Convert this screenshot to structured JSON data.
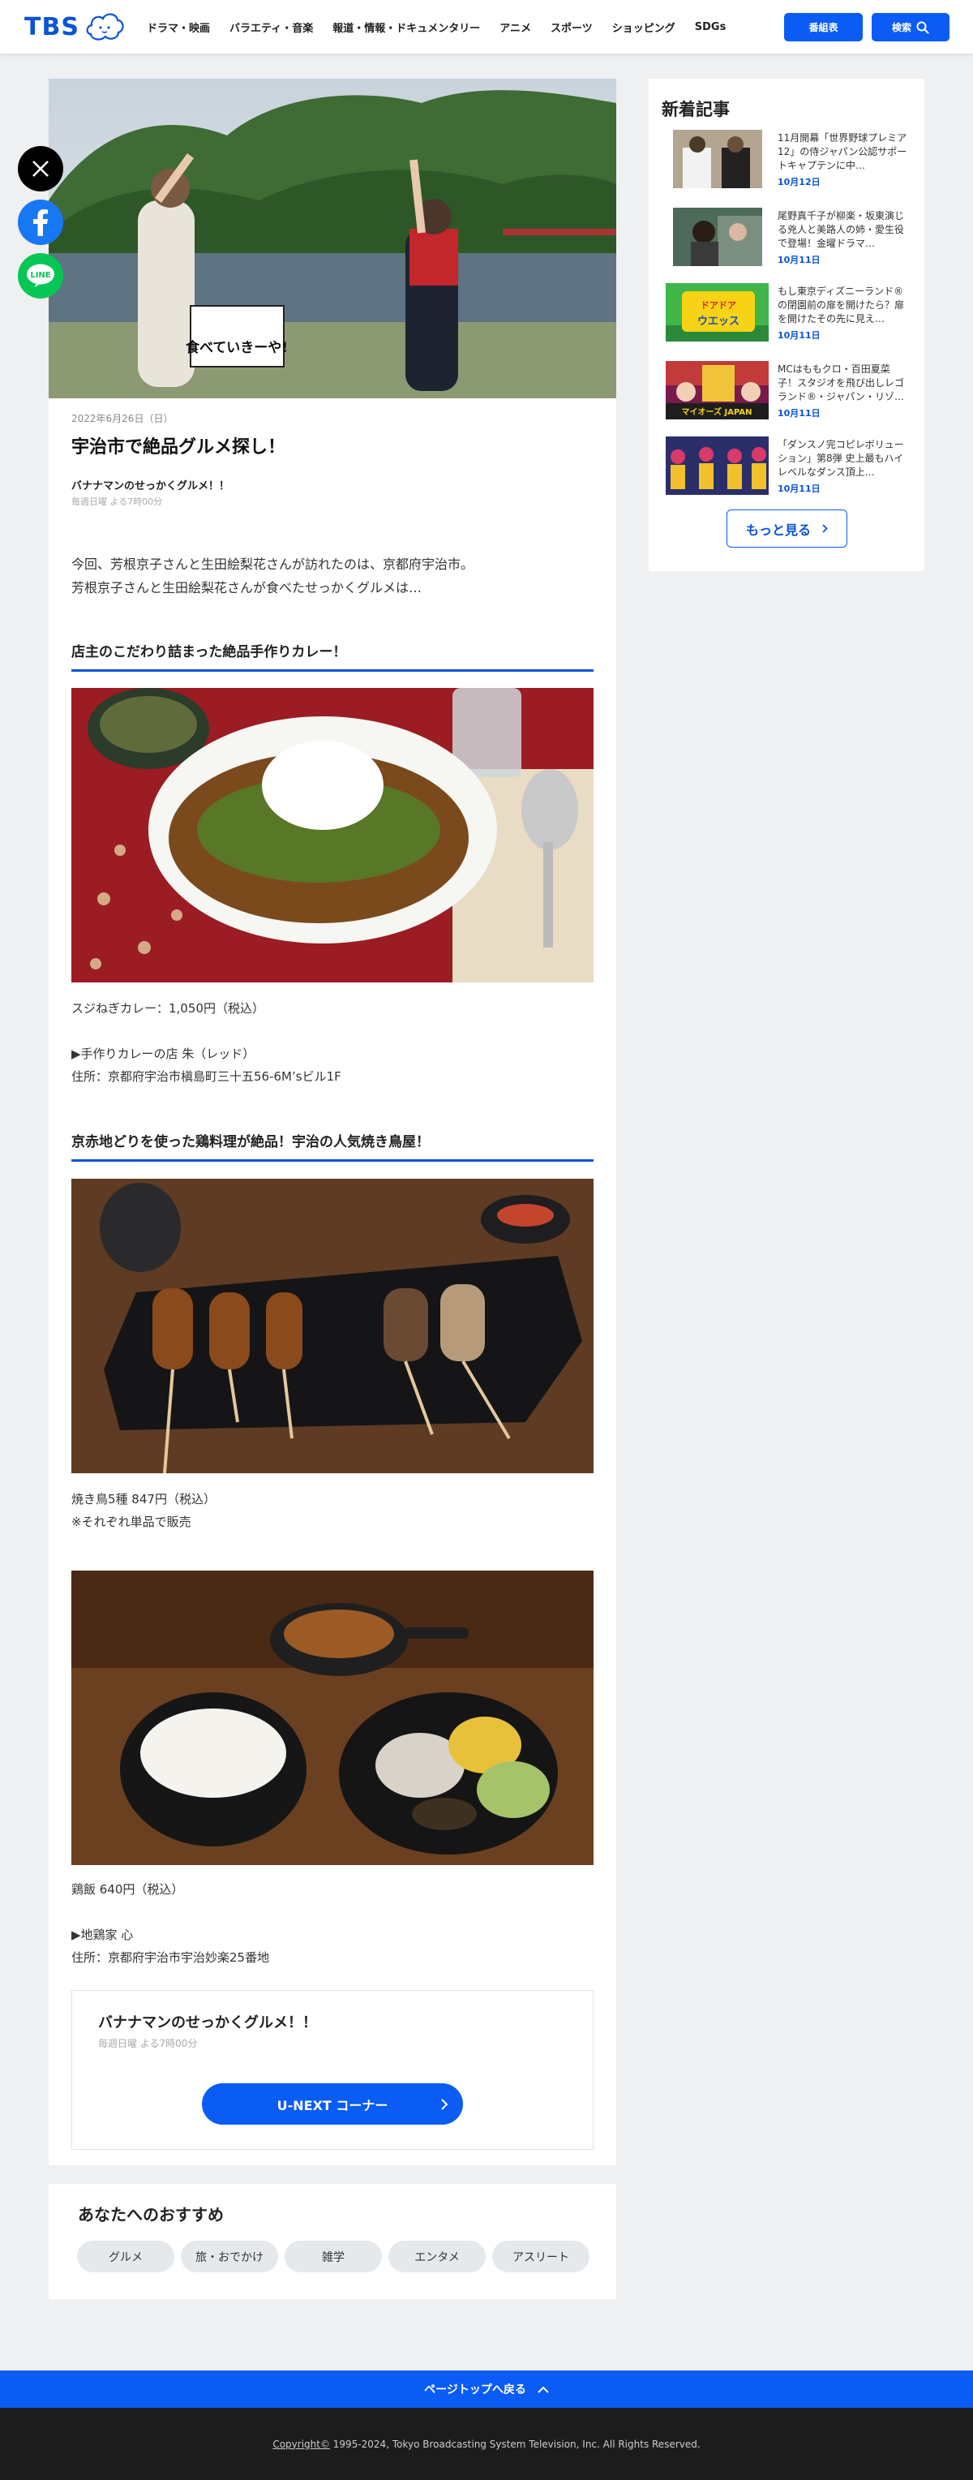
{
  "header": {
    "logo": "TBS",
    "nav": [
      "ドラマ・映画",
      "バラエティ・音楽",
      "報道・情報・ドキュメンタリー",
      "アニメ",
      "スポーツ",
      "ショッピング",
      "SDGs"
    ],
    "schedule_btn": "番組表",
    "search_btn": "検索"
  },
  "social": [
    "x-icon",
    "facebook-icon",
    "line-icon"
  ],
  "article": {
    "hero_sign": "食べていきーや!",
    "date": "2022年6月26日（日）",
    "title": "宇治市で絶品グルメ探し！",
    "program": "バナナマンのせっかくグルメ！！",
    "schedule": "毎週日曜 よる7時00分",
    "lead": [
      "今回、芳根京子さんと生田絵梨花さんが訪れたのは、京都府宇治市。",
      "芳根京子さんと生田絵梨花さんが食べたせっかくグルメは…"
    ],
    "sections": [
      {
        "heading": "店主のこだわり詰まった絶品手作りカレー！",
        "lines": [
          "スジねぎカレー：1,050円（税込）",
          "",
          "▶手作りカレーの店 朱（レッド）",
          "住所：京都府宇治市槇島町三十五56-6M’sビル1F"
        ]
      },
      {
        "heading": "京赤地どりを使った鶏料理が絶品！宇治の人気焼き鳥屋！",
        "lines": [
          "焼き鳥5種 847円（税込）",
          "※それぞれ単品で販売"
        ],
        "lines2": [
          "鶏飯 640円（税込）",
          "",
          "▶地鶏家 心",
          "住所：京都府宇治市宇治妙楽25番地"
        ]
      }
    ],
    "program_box": {
      "title": "バナナマンのせっかくグルメ！！",
      "schedule": "毎週日曜 よる7時00分",
      "button": "U-NEXT コーナー"
    }
  },
  "recommend": {
    "title": "あなたへのおすすめ",
    "tags": [
      "グルメ",
      "旅・おでかけ",
      "雑学",
      "エンタメ",
      "アスリート"
    ]
  },
  "sidebar": {
    "title": "新着記事",
    "items": [
      {
        "text": "11月開幕「世界野球プレミア12」の侍ジャパン公認サポートキャプテンに中…",
        "date": "10月12日"
      },
      {
        "text": "尾野真千子が柳楽・坂東演じる兇人と美路人の姉・愛生役で登場！金曜ドラマ…",
        "date": "10月11日"
      },
      {
        "text": "もし東京ディズニーランド®の閉園前の扉を開けたら？扉を開けたその先に見え…",
        "date": "10月11日"
      },
      {
        "text": "MCはももクロ・百田夏菜子！スタジオを飛び出しレゴランド®・ジャパン・リゾ…",
        "date": "10月11日"
      },
      {
        "text": "「ダンスノ完コピレボリューション」第8弾 史上最もハイレベルなダンス頂上…",
        "date": "10月11日"
      }
    ],
    "thumb_labels": [
      "ドアドア",
      "ウエッス",
      "マイオーズ JAPAN"
    ],
    "more": "もっと見る"
  },
  "footer": {
    "totop": "ページトップへ戻る",
    "copyright_link": "Copyright©",
    "copyright": " 1995-2024, Tokyo Broadcasting System Television, Inc. All Rights Reserved."
  }
}
